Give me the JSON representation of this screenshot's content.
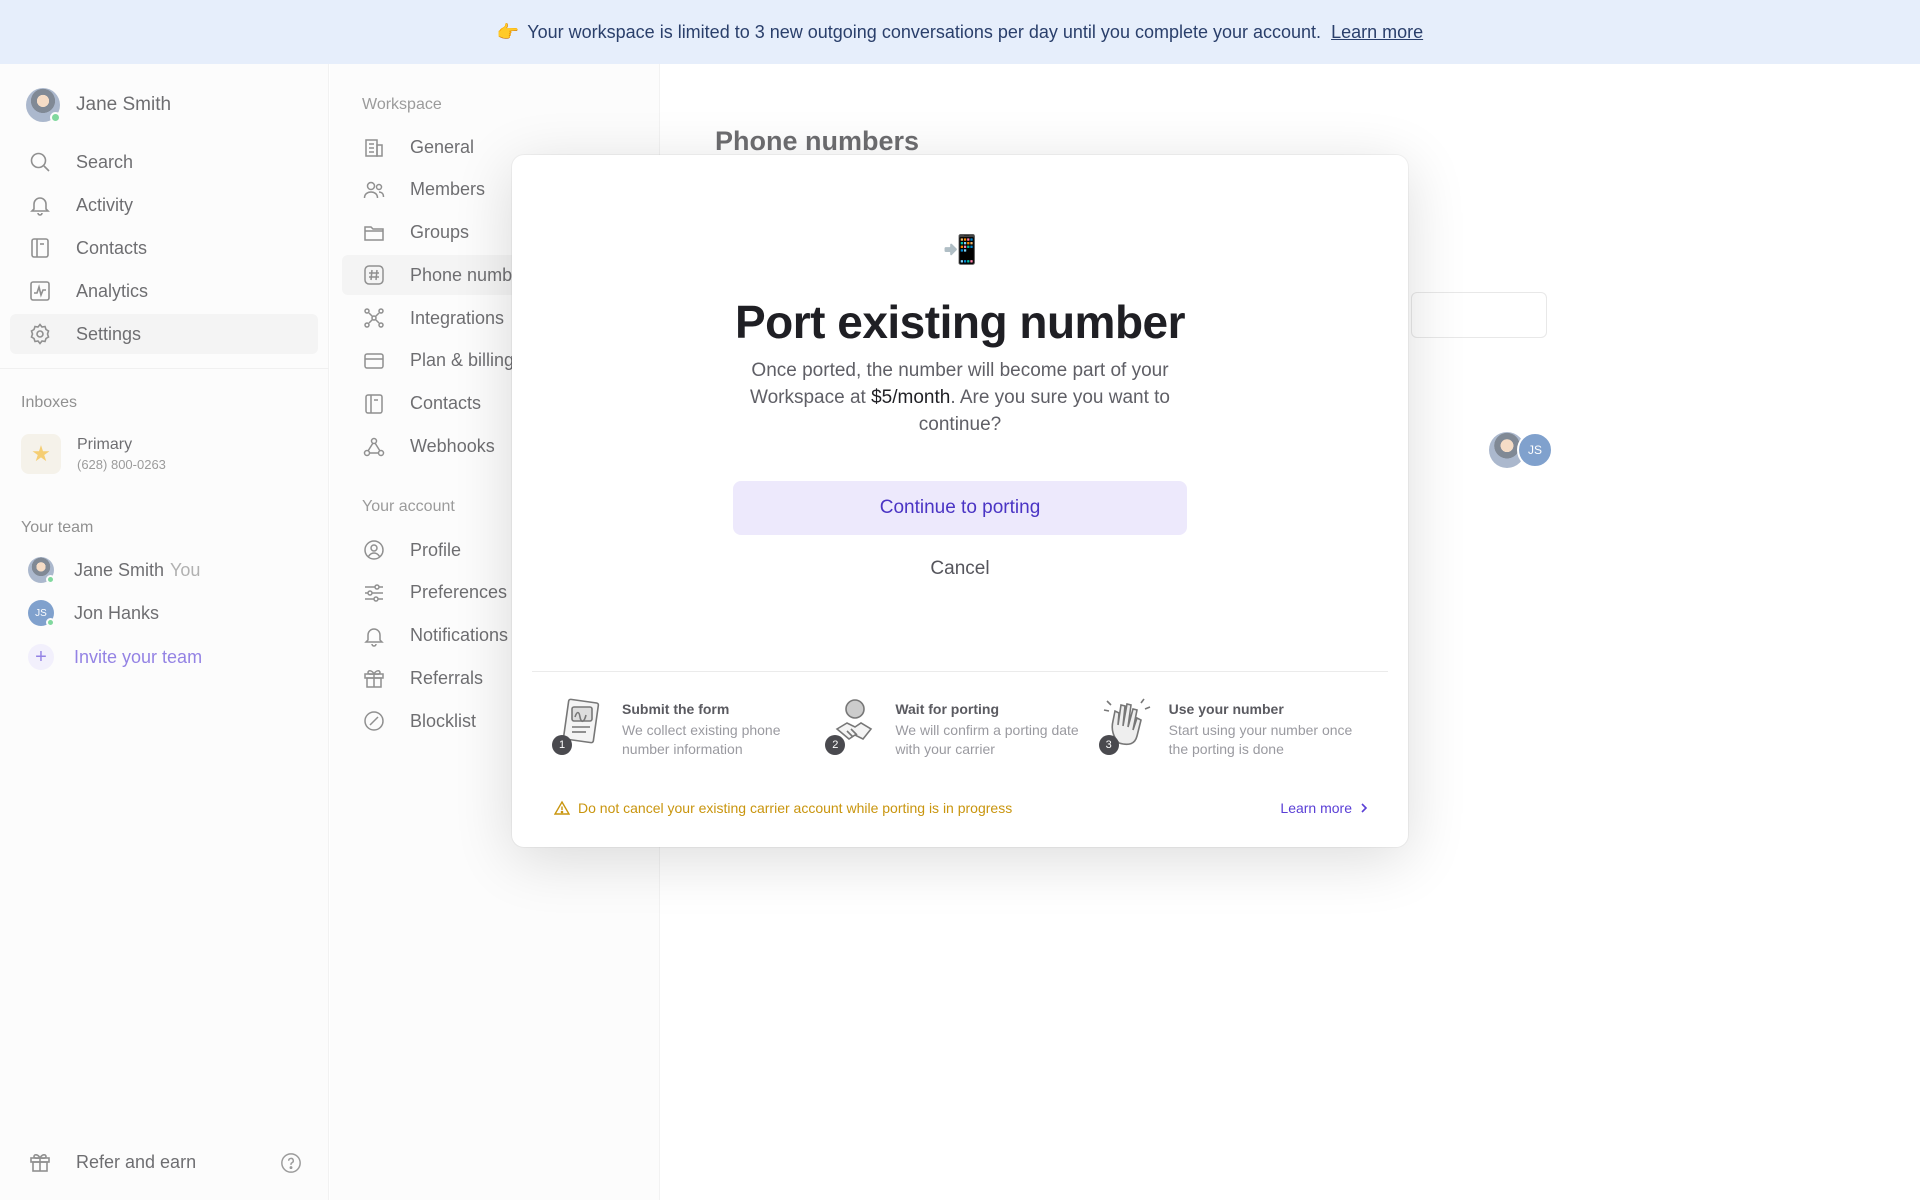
{
  "banner": {
    "emoji": "👉",
    "message": "Your workspace is limited to 3 new outgoing conversations per day until you complete your account.",
    "link": "Learn more"
  },
  "sidebar": {
    "user_name": "Jane Smith",
    "nav": [
      {
        "label": "Search",
        "icon": "search-icon"
      },
      {
        "label": "Activity",
        "icon": "bell-icon"
      },
      {
        "label": "Contacts",
        "icon": "contacts-icon"
      },
      {
        "label": "Analytics",
        "icon": "analytics-icon"
      },
      {
        "label": "Settings",
        "icon": "gear-icon"
      }
    ],
    "inboxes_label": "Inboxes",
    "inbox": {
      "name": "Primary",
      "phone": "(628) 800-0263"
    },
    "team_label": "Your team",
    "team": [
      {
        "name": "Jane Smith",
        "tag": "You"
      },
      {
        "name": "Jon Hanks",
        "initials": "JS"
      }
    ],
    "invite": "Invite your team",
    "refer": "Refer and earn"
  },
  "settings": {
    "workspace_label": "Workspace",
    "workspace_items": [
      "General",
      "Members",
      "Groups",
      "Phone numb",
      "Integrations",
      "Plan & billing",
      "Contacts",
      "Webhooks"
    ],
    "account_label": "Your account",
    "account_items": [
      "Profile",
      "Preferences",
      "Notifications",
      "Referrals",
      "Blocklist"
    ]
  },
  "main": {
    "title": "Phone numbers",
    "avatar_initials": "JS"
  },
  "modal": {
    "emoji": "📲",
    "title": "Port existing number",
    "desc_before": "Once ported, the number will become part of your Workspace at ",
    "desc_price": "$5/month",
    "desc_after": ". Are you sure you want to continue?",
    "primary": "Continue to porting",
    "cancel": "Cancel",
    "steps": [
      {
        "num": "1",
        "title": "Submit the form",
        "text": "We collect existing phone number information"
      },
      {
        "num": "2",
        "title": "Wait for porting",
        "text": "We will confirm a porting date with your carrier"
      },
      {
        "num": "3",
        "title": "Use your number",
        "text": "Start using your number once the porting is done"
      }
    ],
    "warning": "Do not cancel your existing carrier account while porting is in progress",
    "learn_more": "Learn more"
  },
  "colors": {
    "accent": "#5a3fd6",
    "banner_bg": "#e6eefb",
    "warning": "#c9950e",
    "online": "#3dc46a"
  }
}
